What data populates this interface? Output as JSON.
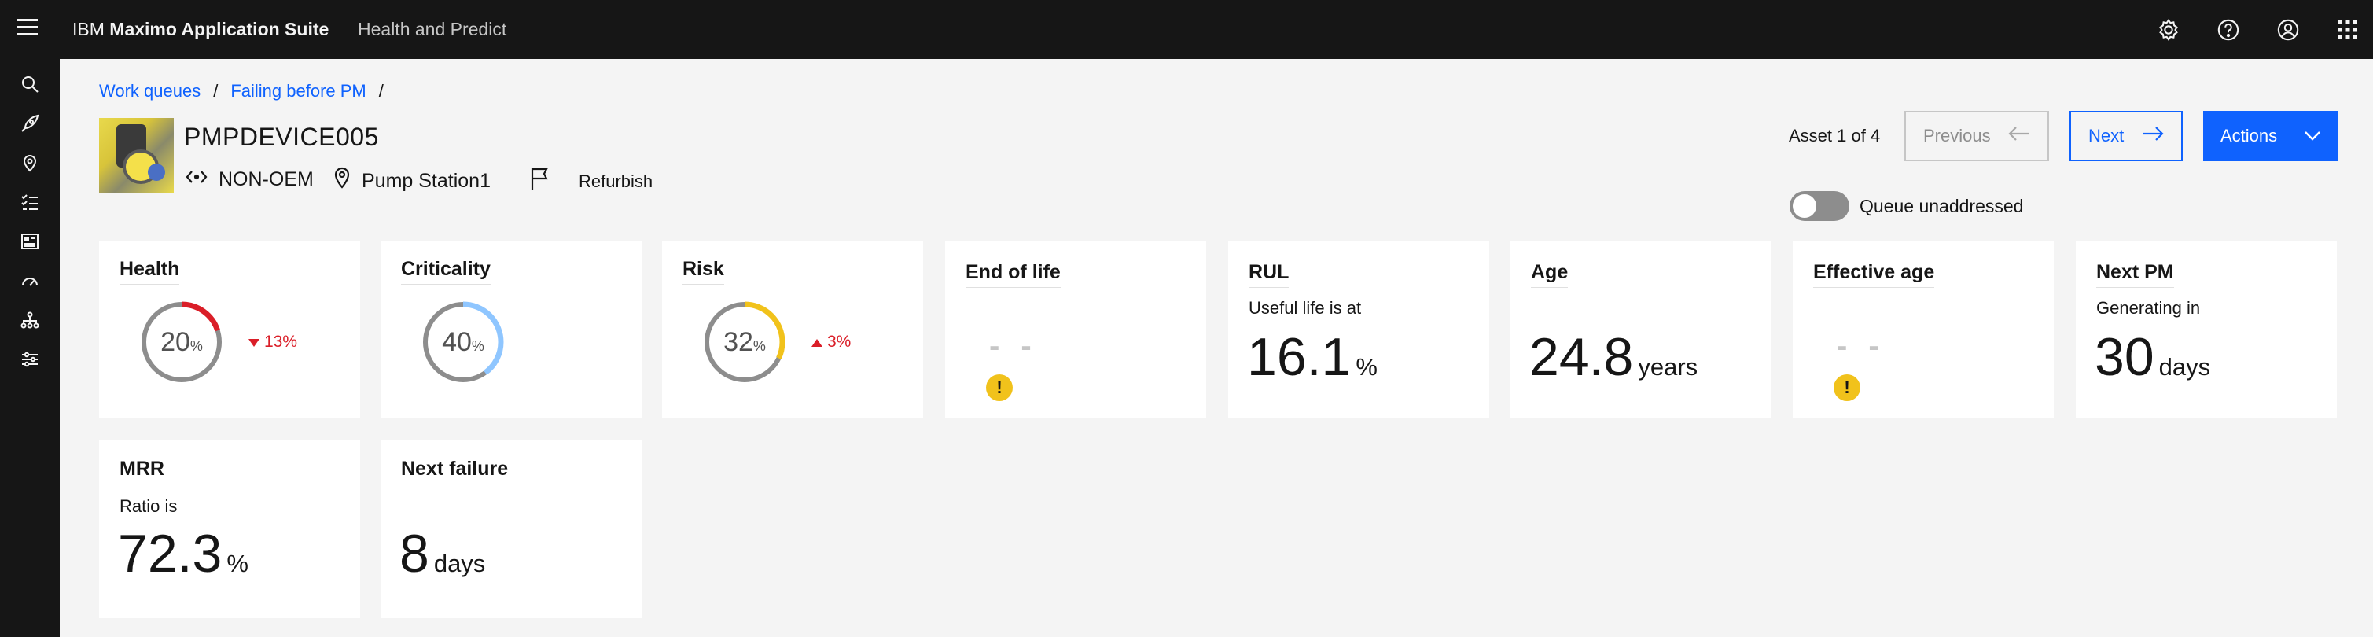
{
  "header": {
    "brand_prefix": "IBM ",
    "brand_name": "Maximo Application Suite",
    "product": "Health and Predict",
    "icons": [
      "menu-icon",
      "settings-icon",
      "help-icon",
      "user-icon",
      "app-switcher-icon"
    ]
  },
  "sidenav": {
    "icons": [
      "search-icon",
      "rocket-icon",
      "location-icon",
      "checklist-icon",
      "dashboard-icon",
      "meter-icon",
      "hierarchy-icon",
      "sliders-icon"
    ]
  },
  "breadcrumb": {
    "items": [
      "Work queues",
      "Failing before PM"
    ],
    "separator": "/"
  },
  "asset": {
    "id": "PMPDEVICE005",
    "type": "NON-OEM",
    "location": "Pump Station1",
    "flag_label": "Refurbish"
  },
  "navigation": {
    "count": "Asset 1 of 4",
    "previous": "Previous",
    "next": "Next",
    "actions": "Actions",
    "queue_toggle_label": "Queue unaddressed",
    "queue_toggle_on": false
  },
  "cards": {
    "health": {
      "title": "Health",
      "value": "20",
      "unit": "%",
      "percent": 20,
      "color": "#da1e28",
      "trend": "13%",
      "trend_dir": "down"
    },
    "criticality": {
      "title": "Criticality",
      "value": "40",
      "unit": "%",
      "percent": 40,
      "color": "#8fc6ff"
    },
    "risk": {
      "title": "Risk",
      "value": "32",
      "unit": "%",
      "percent": 32,
      "color": "#f1c21b",
      "trend": "3%",
      "trend_dir": "up"
    },
    "end_of_life": {
      "title": "End of life",
      "value": "- -"
    },
    "rul": {
      "title": "RUL",
      "subtitle": "Useful life is at",
      "value": "16.1",
      "unit": "%"
    },
    "age": {
      "title": "Age",
      "value": "24.8",
      "unit": "years"
    },
    "effective_age": {
      "title": "Effective age",
      "value": "- -"
    },
    "next_pm": {
      "title": "Next PM",
      "subtitle": "Generating in",
      "value": "30",
      "unit": "days"
    },
    "mrr": {
      "title": "MRR",
      "subtitle": "Ratio is",
      "value": "72.3",
      "unit": "%"
    },
    "next_failure": {
      "title": "Next failure",
      "value": "8",
      "unit": "days"
    }
  }
}
